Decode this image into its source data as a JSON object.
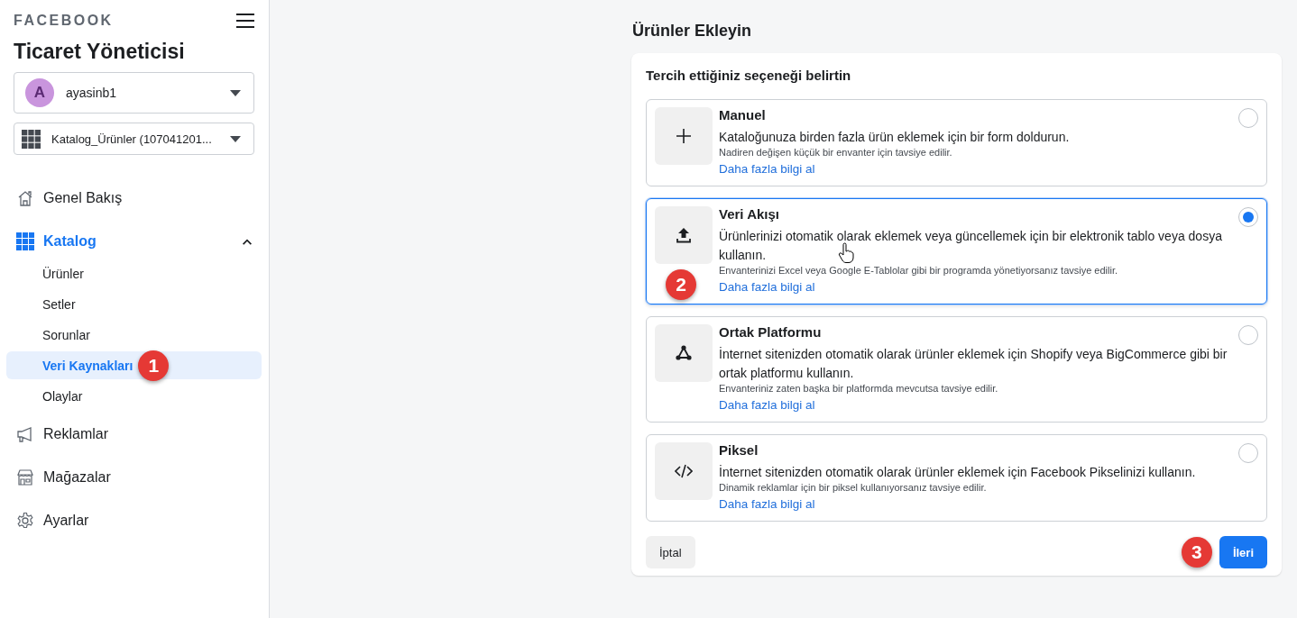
{
  "sidebar": {
    "brand": "FACEBOOK",
    "title": "Ticaret Yöneticisi",
    "account": {
      "avatar": "A",
      "name": "ayasinb1"
    },
    "catalog": {
      "name": "Katalog_Ürünler (107041201..."
    },
    "nav": [
      {
        "kind": "top",
        "label": "Genel Bakış",
        "selected": false
      },
      {
        "kind": "top",
        "label": "Katalog",
        "selected": true,
        "expanded": true,
        "children": [
          {
            "label": "Ürünler",
            "selected": false
          },
          {
            "label": "Setler",
            "selected": false
          },
          {
            "label": "Sorunlar",
            "selected": false
          },
          {
            "label": "Veri Kaynakları",
            "selected": true,
            "callout": "1"
          },
          {
            "label": "Olaylar",
            "selected": false
          }
        ]
      },
      {
        "kind": "top",
        "label": "Reklamlar",
        "selected": false
      },
      {
        "kind": "top",
        "label": "Mağazalar",
        "selected": false
      },
      {
        "kind": "top",
        "label": "Ayarlar",
        "selected": false
      }
    ]
  },
  "main": {
    "heading": "Ürünler Ekleyin",
    "prompt": "Tercih ettiğiniz seçeneği belirtin",
    "options": [
      {
        "title": "Manuel",
        "description": "Kataloğunuza birden fazla ürün eklemek için bir form doldurun.",
        "note": "Nadiren değişen küçük bir envanter için tavsiye edilir.",
        "link": "Daha fazla bilgi al",
        "selected": false,
        "pointer": false
      },
      {
        "title": "Veri Akışı",
        "description": "Ürünlerinizi otomatik olarak eklemek veya güncellemek için bir elektronik tablo veya dosya kullanın.",
        "note": "Envanterinizi Excel veya Google E-Tablolar gibi bir programda yönetiyorsanız tavsiye edilir.",
        "link": "Daha fazla bilgi al",
        "selected": true,
        "pointer": true,
        "callout": "2"
      },
      {
        "title": "Ortak Platformu",
        "description": "İnternet sitenizden otomatik olarak ürünler eklemek için Shopify veya BigCommerce gibi bir ortak platformu kullanın.",
        "note": "Envanteriniz zaten başka bir platformda mevcutsa tavsiye edilir.",
        "link": "Daha fazla bilgi al",
        "selected": false,
        "pointer": false
      },
      {
        "title": "Piksel",
        "description": "İnternet sitenizden otomatik olarak ürünler eklemek için Facebook Pikselinizi kullanın.",
        "note": "Dinamik reklamlar için bir piksel kullanıyorsanız tavsiye edilir.",
        "link": "Daha fazla bilgi al",
        "selected": false,
        "pointer": false
      }
    ],
    "cancel": "İptal",
    "next": {
      "label": "İleri",
      "callout": "3"
    }
  }
}
